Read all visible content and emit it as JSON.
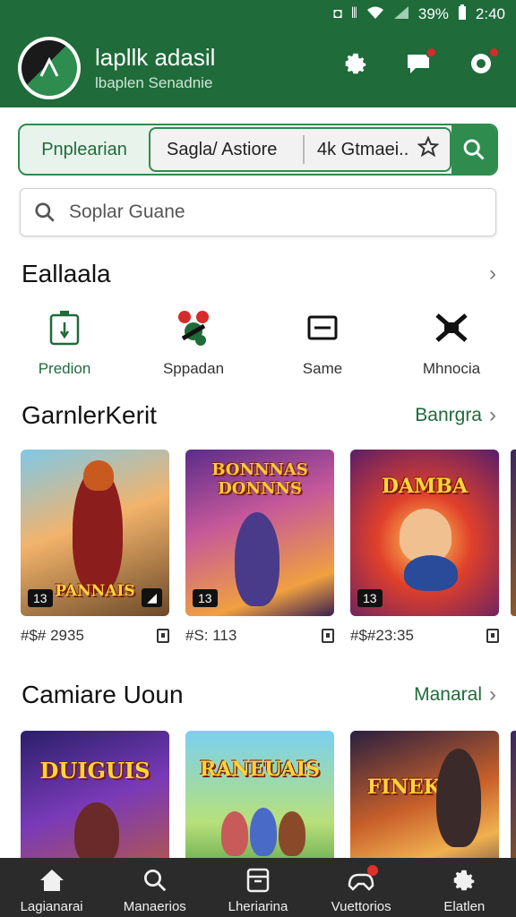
{
  "status_bar": {
    "battery": "39%",
    "time": "2:40"
  },
  "header": {
    "title": "lapllk adasil",
    "subtitle": "lbaplen Senadnie"
  },
  "filter": {
    "label": "Pnplearian",
    "segment_a": "Sagla/ Astiore",
    "segment_b": "4k Gtmaei.."
  },
  "search": {
    "placeholder": "Soplar Guane"
  },
  "section1": {
    "title": "Eallaala",
    "categories": [
      {
        "label": "Predion",
        "icon": "controller-icon",
        "active": true
      },
      {
        "label": "Sppadan",
        "icon": "tokens-icon",
        "active": false
      },
      {
        "label": "Same",
        "icon": "card-icon",
        "active": false
      },
      {
        "label": "Mhnocia",
        "icon": "swords-icon",
        "active": false
      }
    ]
  },
  "section2": {
    "title": "GarnlerKerit",
    "link": "Banrgra",
    "games": [
      {
        "art_title": "PANNAIS",
        "badge": "13",
        "meta": "#$# 2935"
      },
      {
        "art_title": "BONNNAS DONNNS",
        "badge": "13",
        "meta": "#S: 113"
      },
      {
        "art_title": "DAMBA",
        "badge": "13",
        "meta": "#$#23:35"
      }
    ]
  },
  "section3": {
    "title": "Camiare Uoun",
    "link": "Manaral",
    "games": [
      {
        "art_title": "DUIGUIS"
      },
      {
        "art_title": "RANEUAIS"
      },
      {
        "art_title": "FINEKAI"
      }
    ]
  },
  "nav": [
    {
      "label": "Lagianarai",
      "icon": "home-icon"
    },
    {
      "label": "Manaerios",
      "icon": "search-icon"
    },
    {
      "label": "Lheriarina",
      "icon": "library-icon"
    },
    {
      "label": "Vuettorios",
      "icon": "gamepad-icon"
    },
    {
      "label": "Elatlen",
      "icon": "gear-icon"
    }
  ],
  "colors": {
    "brand": "#1f6b3a",
    "accent": "#2f8c4f",
    "nav_bg": "#2b2b2b",
    "badge_red": "#d62b2b"
  }
}
